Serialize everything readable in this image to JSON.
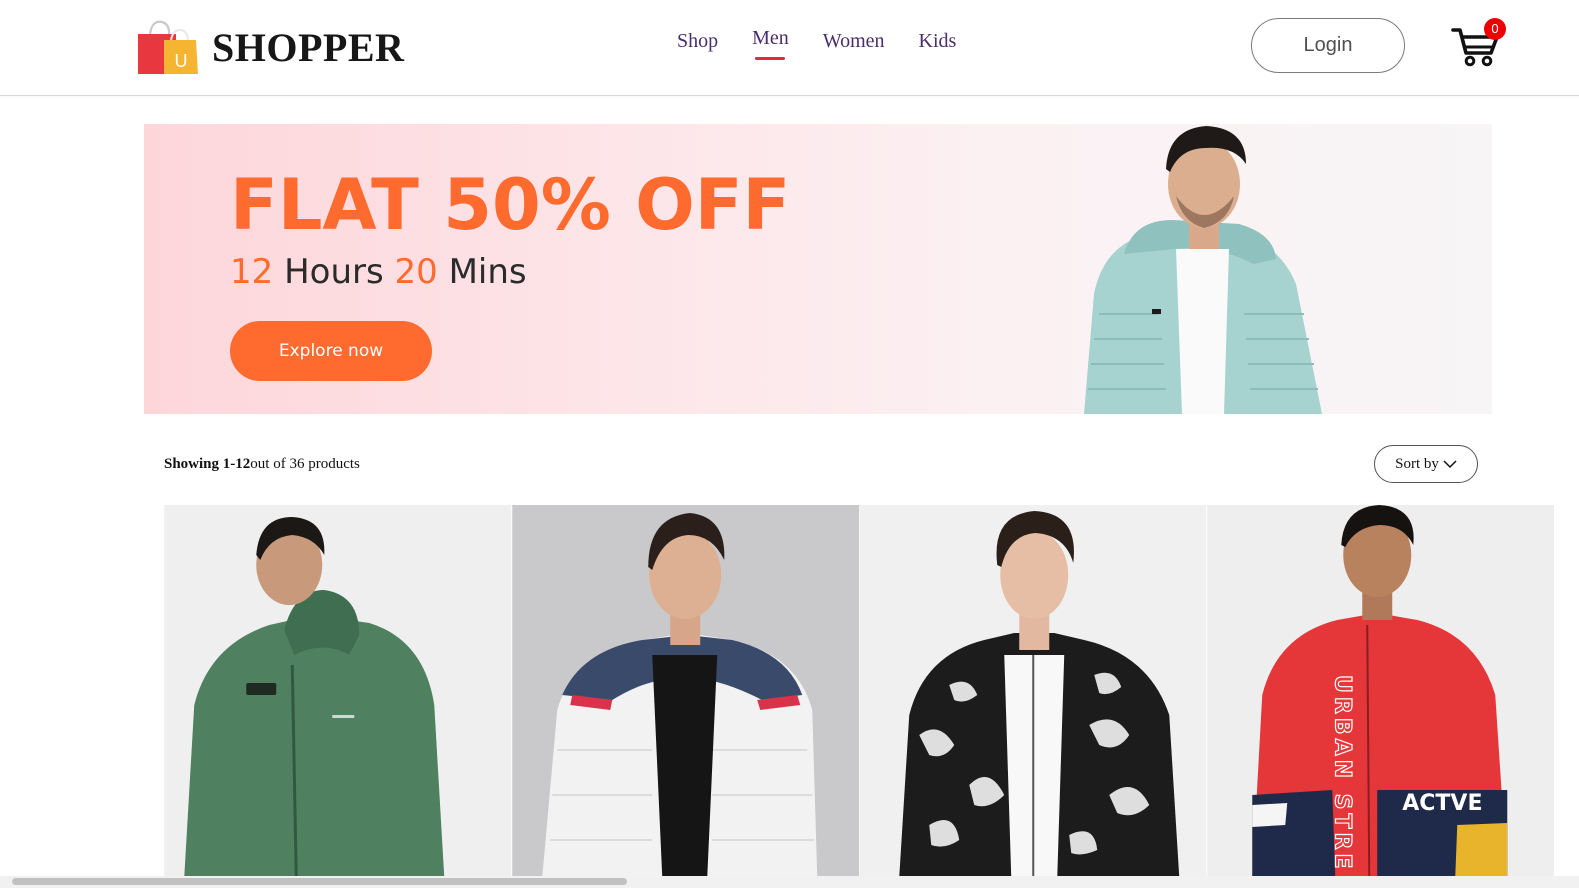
{
  "brand": {
    "name": "SHOPPER",
    "logo_letter": "U"
  },
  "nav": {
    "items": [
      {
        "label": "Shop",
        "active": false
      },
      {
        "label": "Men",
        "active": true
      },
      {
        "label": "Women",
        "active": false
      },
      {
        "label": "Kids",
        "active": false
      }
    ]
  },
  "header": {
    "login_label": "Login",
    "cart_count": "0"
  },
  "hero": {
    "title": "FLAT 50% OFF",
    "hours_value": "12",
    "hours_label": "Hours",
    "mins_value": "20",
    "mins_label": "Mins",
    "cta_label": "Explore now"
  },
  "results": {
    "showing_label": "Showing 1-12",
    "total_text": "out of 36 products",
    "sort_label": "Sort by"
  },
  "products": [
    {
      "name": "green-hooded-jacket",
      "jacket_color": "#4f8060",
      "bg": "#efefef"
    },
    {
      "name": "white-navy-puffer-jacket",
      "jacket_color": "#f2f2f2",
      "bg": "#c9c9cc"
    },
    {
      "name": "black-white-marble-bomber",
      "jacket_color": "#1c1c1c",
      "bg": "#f0f0f0"
    },
    {
      "name": "red-urban-street-jacket",
      "jacket_color": "#e5363a",
      "bg": "#eeeeee",
      "print_text_1": "URBAN STRE",
      "print_text_2": "ACTVE"
    }
  ],
  "colors": {
    "accent": "#ff6a2e",
    "nav_text": "#4a2d6b",
    "underline": "#e02b3c",
    "badge": "#ef0000"
  }
}
